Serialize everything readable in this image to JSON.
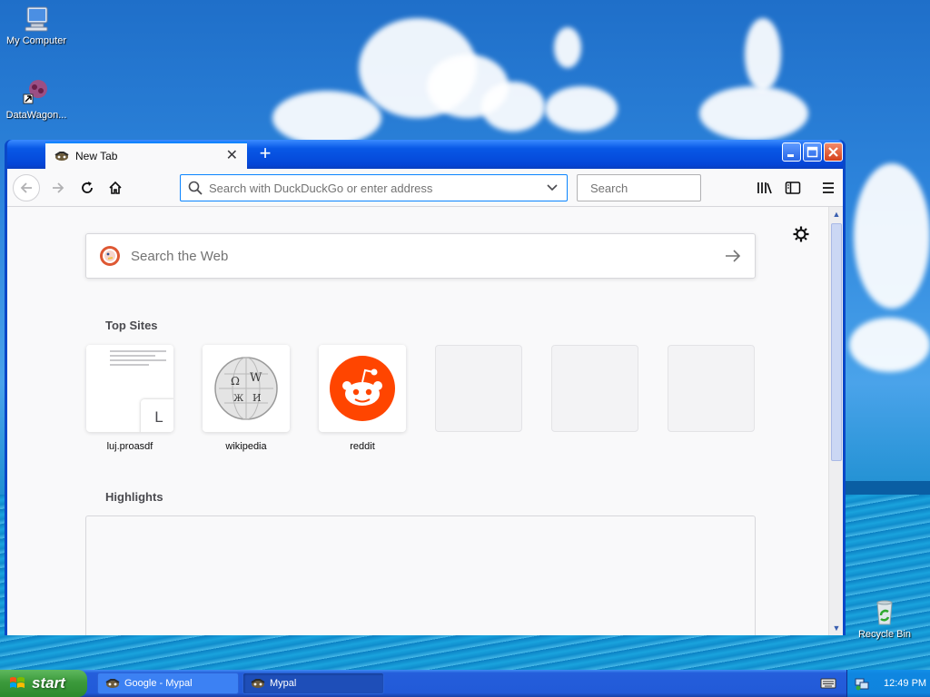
{
  "desktop": {
    "icons": [
      {
        "label": "My Computer",
        "icon": "my-computer-icon"
      },
      {
        "label": "DataWagon...",
        "icon": "datawagon-icon"
      },
      {
        "label": "Recycle Bin",
        "icon": "recycle-bin-icon"
      }
    ]
  },
  "browser": {
    "tab": {
      "title": "New Tab",
      "close": "✕"
    },
    "new_tab_label": "+",
    "urlbar": {
      "placeholder": "Search with DuckDuckGo or enter address"
    },
    "searchbar": {
      "placeholder": "Search"
    },
    "newtab": {
      "web_search_placeholder": "Search the Web",
      "top_sites_title": "Top Sites",
      "top_sites": [
        {
          "label": "luj.proasdf",
          "letter": "L",
          "kind": "screenshot"
        },
        {
          "label": "wikipedia",
          "kind": "wikipedia"
        },
        {
          "label": "reddit",
          "kind": "reddit"
        },
        {
          "label": "",
          "kind": "empty"
        },
        {
          "label": "",
          "kind": "empty"
        },
        {
          "label": "",
          "kind": "empty"
        }
      ],
      "highlights_title": "Highlights"
    }
  },
  "taskbar": {
    "start_label": "start",
    "tasks": [
      {
        "label": "Google - Mypal",
        "active": false
      },
      {
        "label": "Mypal",
        "active": true
      }
    ],
    "clock": "12:49 PM"
  },
  "colors": {
    "accent": "#0a84ff",
    "reddit": "#ff4500",
    "xp_blue": "#245edb",
    "start_green": "#3c9a3c"
  }
}
